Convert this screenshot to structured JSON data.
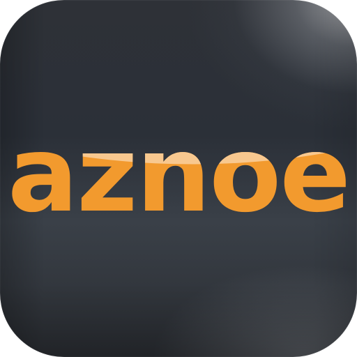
{
  "app_icon": {
    "name": "aznoe",
    "logo_text": "aznoe"
  },
  "colors": {
    "logo_orange": "#f29a2e",
    "logo_highlight": "#f8c88f",
    "background_dark": "#2b3038"
  }
}
